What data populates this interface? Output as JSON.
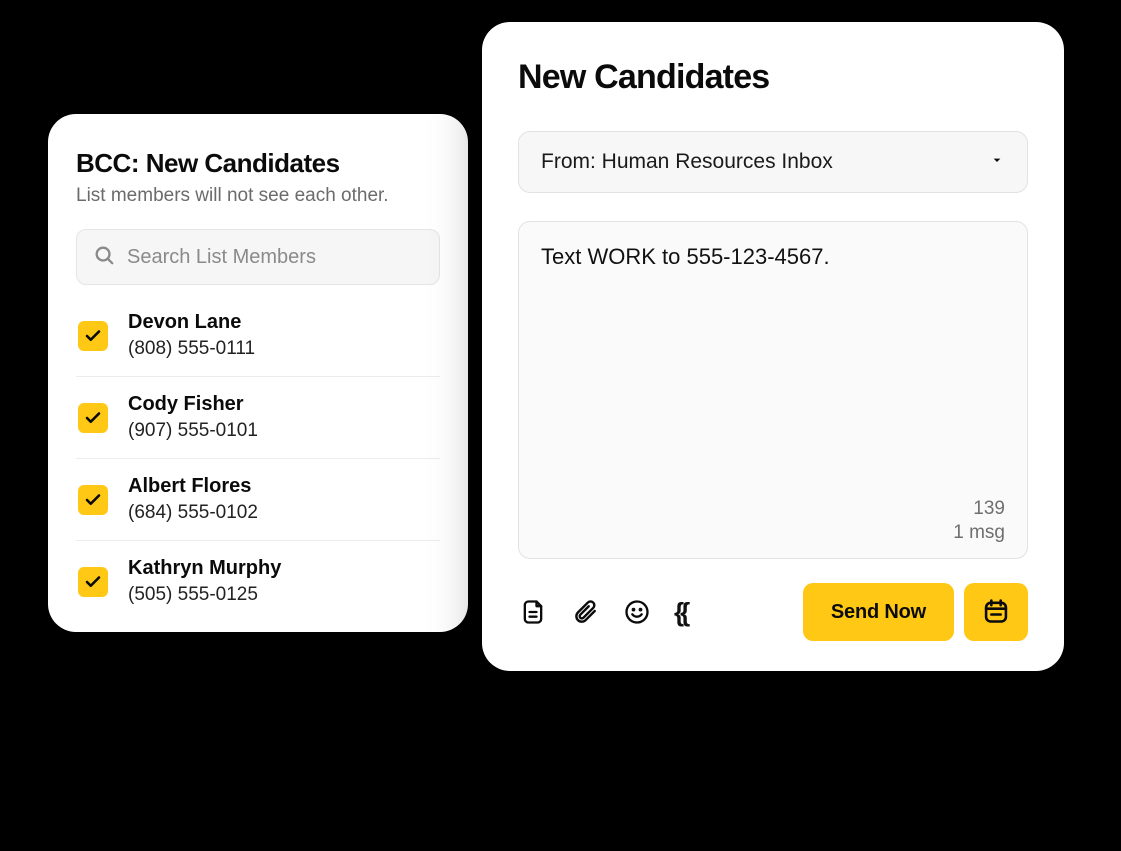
{
  "bcc_panel": {
    "title": "BCC: New Candidates",
    "subtitle": "List members will not see each other.",
    "search_placeholder": "Search List Members",
    "members": [
      {
        "name": "Devon Lane",
        "phone": "(808) 555-0111",
        "checked": true
      },
      {
        "name": "Cody Fisher",
        "phone": "(907) 555-0101",
        "checked": true
      },
      {
        "name": "Albert Flores",
        "phone": "(684) 555-0102",
        "checked": true
      },
      {
        "name": "Kathryn Murphy",
        "phone": "(505) 555-0125",
        "checked": true
      }
    ]
  },
  "compose_panel": {
    "title": "New Candidates",
    "from_label": "From: Human Resources Inbox",
    "message_text": "Text WORK to 555-123-4567.",
    "char_count": "139",
    "msg_count": "1 msg",
    "send_label": "Send Now"
  },
  "icons": {
    "search": "search-icon",
    "check": "check-icon",
    "chevron_down": "chevron-down-icon",
    "template": "template-icon",
    "attachment": "paperclip-icon",
    "emoji": "smile-icon",
    "variables": "braces-icon",
    "schedule": "calendar-icon"
  },
  "colors": {
    "accent": "#ffc815",
    "text": "#0b0b0b",
    "muted": "#6f6f6f",
    "panel_bg": "#ffffff",
    "input_bg": "#f7f7f7"
  }
}
